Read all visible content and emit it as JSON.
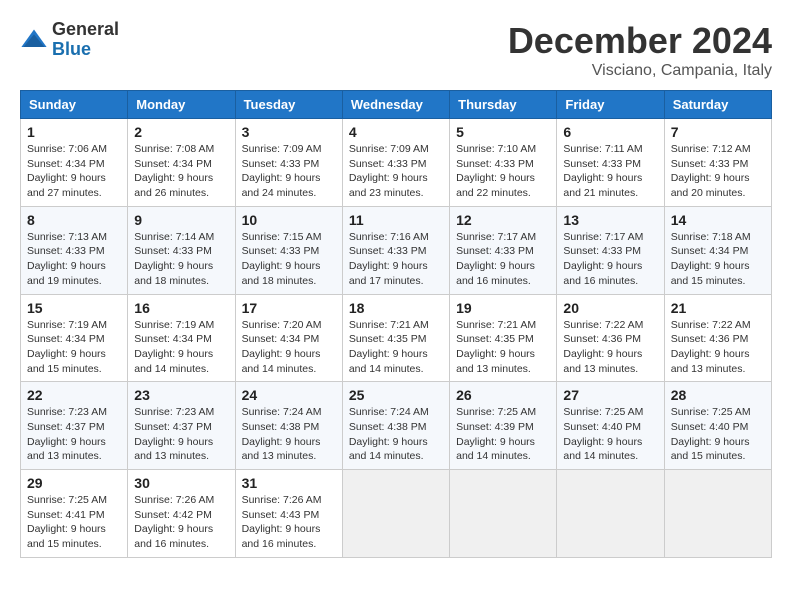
{
  "header": {
    "logo": {
      "general": "General",
      "blue": "Blue"
    },
    "title": "December 2024",
    "location": "Visciano, Campania, Italy"
  },
  "weekdays": [
    "Sunday",
    "Monday",
    "Tuesday",
    "Wednesday",
    "Thursday",
    "Friday",
    "Saturday"
  ],
  "weeks": [
    [
      {
        "day": 1,
        "sunrise": "7:06 AM",
        "sunset": "4:34 PM",
        "daylight": "9 hours and 27 minutes."
      },
      {
        "day": 2,
        "sunrise": "7:08 AM",
        "sunset": "4:34 PM",
        "daylight": "9 hours and 26 minutes."
      },
      {
        "day": 3,
        "sunrise": "7:09 AM",
        "sunset": "4:33 PM",
        "daylight": "9 hours and 24 minutes."
      },
      {
        "day": 4,
        "sunrise": "7:09 AM",
        "sunset": "4:33 PM",
        "daylight": "9 hours and 23 minutes."
      },
      {
        "day": 5,
        "sunrise": "7:10 AM",
        "sunset": "4:33 PM",
        "daylight": "9 hours and 22 minutes."
      },
      {
        "day": 6,
        "sunrise": "7:11 AM",
        "sunset": "4:33 PM",
        "daylight": "9 hours and 21 minutes."
      },
      {
        "day": 7,
        "sunrise": "7:12 AM",
        "sunset": "4:33 PM",
        "daylight": "9 hours and 20 minutes."
      }
    ],
    [
      {
        "day": 8,
        "sunrise": "7:13 AM",
        "sunset": "4:33 PM",
        "daylight": "9 hours and 19 minutes."
      },
      {
        "day": 9,
        "sunrise": "7:14 AM",
        "sunset": "4:33 PM",
        "daylight": "9 hours and 18 minutes."
      },
      {
        "day": 10,
        "sunrise": "7:15 AM",
        "sunset": "4:33 PM",
        "daylight": "9 hours and 18 minutes."
      },
      {
        "day": 11,
        "sunrise": "7:16 AM",
        "sunset": "4:33 PM",
        "daylight": "9 hours and 17 minutes."
      },
      {
        "day": 12,
        "sunrise": "7:17 AM",
        "sunset": "4:33 PM",
        "daylight": "9 hours and 16 minutes."
      },
      {
        "day": 13,
        "sunrise": "7:17 AM",
        "sunset": "4:33 PM",
        "daylight": "9 hours and 16 minutes."
      },
      {
        "day": 14,
        "sunrise": "7:18 AM",
        "sunset": "4:34 PM",
        "daylight": "9 hours and 15 minutes."
      }
    ],
    [
      {
        "day": 15,
        "sunrise": "7:19 AM",
        "sunset": "4:34 PM",
        "daylight": "9 hours and 15 minutes."
      },
      {
        "day": 16,
        "sunrise": "7:19 AM",
        "sunset": "4:34 PM",
        "daylight": "9 hours and 14 minutes."
      },
      {
        "day": 17,
        "sunrise": "7:20 AM",
        "sunset": "4:34 PM",
        "daylight": "9 hours and 14 minutes."
      },
      {
        "day": 18,
        "sunrise": "7:21 AM",
        "sunset": "4:35 PM",
        "daylight": "9 hours and 14 minutes."
      },
      {
        "day": 19,
        "sunrise": "7:21 AM",
        "sunset": "4:35 PM",
        "daylight": "9 hours and 13 minutes."
      },
      {
        "day": 20,
        "sunrise": "7:22 AM",
        "sunset": "4:36 PM",
        "daylight": "9 hours and 13 minutes."
      },
      {
        "day": 21,
        "sunrise": "7:22 AM",
        "sunset": "4:36 PM",
        "daylight": "9 hours and 13 minutes."
      }
    ],
    [
      {
        "day": 22,
        "sunrise": "7:23 AM",
        "sunset": "4:37 PM",
        "daylight": "9 hours and 13 minutes."
      },
      {
        "day": 23,
        "sunrise": "7:23 AM",
        "sunset": "4:37 PM",
        "daylight": "9 hours and 13 minutes."
      },
      {
        "day": 24,
        "sunrise": "7:24 AM",
        "sunset": "4:38 PM",
        "daylight": "9 hours and 13 minutes."
      },
      {
        "day": 25,
        "sunrise": "7:24 AM",
        "sunset": "4:38 PM",
        "daylight": "9 hours and 14 minutes."
      },
      {
        "day": 26,
        "sunrise": "7:25 AM",
        "sunset": "4:39 PM",
        "daylight": "9 hours and 14 minutes."
      },
      {
        "day": 27,
        "sunrise": "7:25 AM",
        "sunset": "4:40 PM",
        "daylight": "9 hours and 14 minutes."
      },
      {
        "day": 28,
        "sunrise": "7:25 AM",
        "sunset": "4:40 PM",
        "daylight": "9 hours and 15 minutes."
      }
    ],
    [
      {
        "day": 29,
        "sunrise": "7:25 AM",
        "sunset": "4:41 PM",
        "daylight": "9 hours and 15 minutes."
      },
      {
        "day": 30,
        "sunrise": "7:26 AM",
        "sunset": "4:42 PM",
        "daylight": "9 hours and 16 minutes."
      },
      {
        "day": 31,
        "sunrise": "7:26 AM",
        "sunset": "4:43 PM",
        "daylight": "9 hours and 16 minutes."
      },
      null,
      null,
      null,
      null
    ]
  ],
  "labels": {
    "sunrise": "Sunrise:",
    "sunset": "Sunset:",
    "daylight": "Daylight:"
  }
}
